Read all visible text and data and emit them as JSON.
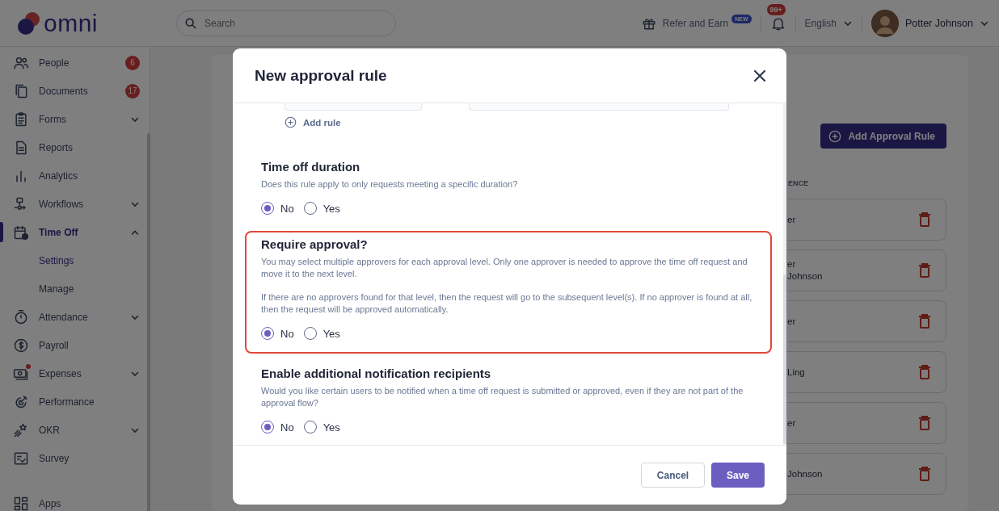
{
  "topbar": {
    "logo": "omni",
    "search": {
      "placeholder": "Search"
    },
    "refer": "Refer and Earn",
    "refer_badge": "NEW",
    "notifications_badge": "99+",
    "language": "English",
    "user": "Potter Johnson"
  },
  "sidebar": {
    "items": [
      {
        "label": "People",
        "badge": "6",
        "selected": false
      },
      {
        "label": "Documents",
        "badge": "17",
        "selected": false
      },
      {
        "label": "Forms",
        "expanded": false,
        "selected": false
      },
      {
        "label": "Reports",
        "selected": false
      },
      {
        "label": "Analytics",
        "selected": false
      },
      {
        "label": "Workflows",
        "expanded": false,
        "selected": false
      },
      {
        "label": "Time Off",
        "expanded": true,
        "selected": true,
        "children": [
          {
            "label": "Settings",
            "selected": true
          },
          {
            "label": "Manage",
            "selected": false
          }
        ]
      },
      {
        "label": "Attendance",
        "expanded": false,
        "selected": false
      },
      {
        "label": "Payroll",
        "selected": false
      },
      {
        "label": "Expenses",
        "expanded": false,
        "selected": false,
        "dot": true
      },
      {
        "label": "Performance",
        "selected": false
      },
      {
        "label": "OKR",
        "expanded": false,
        "selected": false
      },
      {
        "label": "Survey",
        "selected": false
      },
      {
        "label": "Apps",
        "selected": false
      }
    ]
  },
  "background": {
    "add_button": "Add Approval Rule",
    "column_header": "ENCE",
    "rows": [
      {
        "lines": [
          "er"
        ]
      },
      {
        "lines": [
          "er",
          "Johnson"
        ]
      },
      {
        "lines": [
          "er"
        ]
      },
      {
        "lines": [
          "Ling"
        ]
      },
      {
        "lines": [
          "er"
        ]
      },
      {
        "lines": [
          "Johnson"
        ]
      }
    ]
  },
  "modal": {
    "title": "New approval rule",
    "add_rule": "Add rule",
    "sections": [
      {
        "title": "Time off duration",
        "highlighted": false,
        "description": [
          "Does this rule apply to only requests meeting a specific duration?"
        ],
        "options": [
          {
            "label": "No",
            "selected": true
          },
          {
            "label": "Yes",
            "selected": false
          }
        ]
      },
      {
        "title": "Require approval?",
        "highlighted": true,
        "description": [
          "You may select multiple approvers for each approval level. Only one approver is needed to approve the time off request and move it to the next level.",
          "If there are no approvers found for that level, then the request will go to the subsequent level(s). If no approver is found at all, then the request will be approved automatically."
        ],
        "options": [
          {
            "label": "No",
            "selected": true
          },
          {
            "label": "Yes",
            "selected": false
          }
        ]
      },
      {
        "title": "Enable additional notification recipients",
        "highlighted": false,
        "description": [
          "Would you like certain users to be notified when a time off request is submitted or approved, even if they are not part of the approval flow?"
        ],
        "options": [
          {
            "label": "No",
            "selected": true
          },
          {
            "label": "Yes",
            "selected": false
          }
        ]
      }
    ],
    "buttons": {
      "cancel": "Cancel",
      "save": "Save"
    }
  }
}
